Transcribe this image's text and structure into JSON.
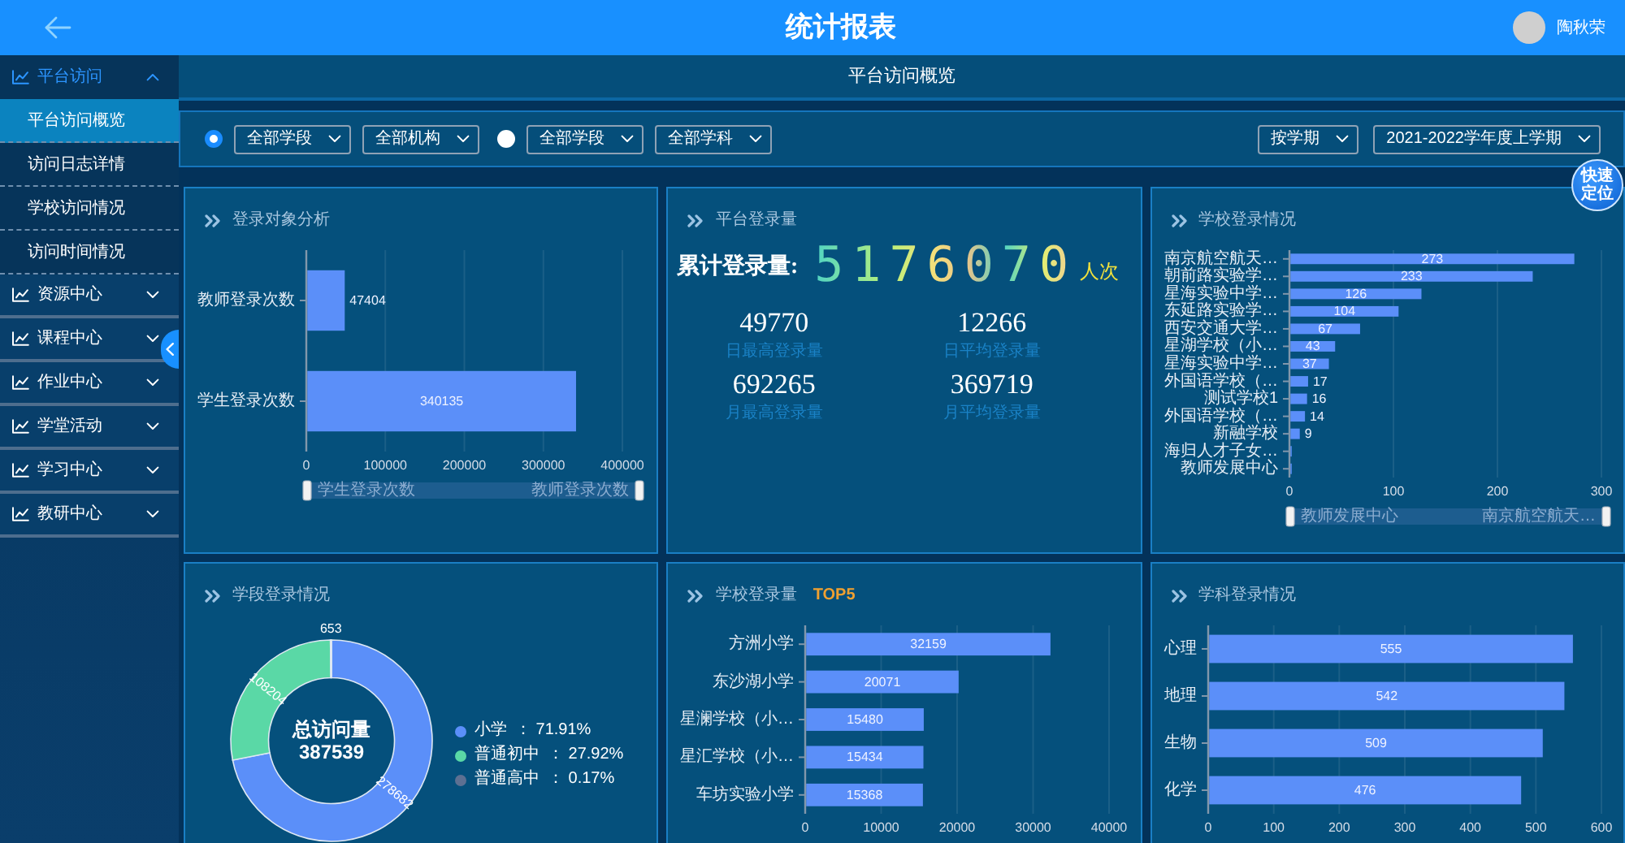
{
  "header": {
    "title": "统计报表",
    "user_name": "陶秋荣"
  },
  "sidebar": {
    "groups": [
      {
        "label": "平台访问",
        "expanded": true,
        "children": [
          {
            "label": "平台访问概览",
            "selected": true
          },
          {
            "label": "访问日志详情",
            "selected": false
          },
          {
            "label": "学校访问情况",
            "selected": false
          },
          {
            "label": "访问时间情况",
            "selected": false
          }
        ]
      },
      {
        "label": "资源中心",
        "expanded": false
      },
      {
        "label": "课程中心",
        "expanded": false
      },
      {
        "label": "作业中心",
        "expanded": false
      },
      {
        "label": "学堂活动",
        "expanded": false
      },
      {
        "label": "学习中心",
        "expanded": false
      },
      {
        "label": "教研中心",
        "expanded": false
      }
    ]
  },
  "page_title": "平台访问概览",
  "filter_groups": [
    {
      "selected": true,
      "selects": [
        "全部学段",
        "全部机构"
      ]
    },
    {
      "selected": false,
      "selects": [
        "全部学段",
        "全部学科"
      ]
    }
  ],
  "term_filters": [
    "按学期",
    "2021-2022学年度上学期"
  ],
  "quick_locate": "快速定位",
  "panels": [
    {
      "kind": "chart",
      "title": "登录对象分析",
      "chart_data": {
        "type": "bar",
        "orientation": "horizontal",
        "categories": [
          "教师登录次数",
          "学生登录次数"
        ],
        "values": [
          47404,
          340135
        ],
        "xlim": [
          0,
          400000
        ],
        "xticks": [
          0,
          100000,
          200000,
          300000,
          400000
        ],
        "data_labels": true,
        "grid": true
      },
      "zoom_slider": {
        "start_label": "学生登录次数",
        "end_label": "教师登录次数"
      }
    },
    {
      "kind": "stats",
      "title": "平台登录量",
      "total": {
        "label": "累计登录量:",
        "value": "5176070",
        "unit": "人次"
      },
      "stats": [
        {
          "value": "49770",
          "label": "日最高登录量"
        },
        {
          "value": "12266",
          "label": "日平均登录量"
        },
        {
          "value": "692265",
          "label": "月最高登录量"
        },
        {
          "value": "369719",
          "label": "月平均登录量"
        }
      ]
    },
    {
      "kind": "chart",
      "title": "学校登录情况",
      "chart_data": {
        "type": "bar",
        "orientation": "horizontal",
        "categories": [
          "南京航空航天…",
          "朝前路实验学…",
          "星海实验中学…",
          "东延路实验学…",
          "西安交通大学…",
          "星湖学校（小…",
          "星海实验中学…",
          "外国语学校（…",
          "测试学校1",
          "外国语学校（…",
          "新融学校",
          "海归人才子女…",
          "教师发展中心"
        ],
        "values": [
          273,
          233,
          126,
          104,
          67,
          43,
          37,
          17,
          16,
          14,
          9,
          1,
          1
        ],
        "value_labels": [
          "273",
          "233",
          "126",
          "104",
          "67",
          "43",
          "37",
          "17",
          "16",
          "14",
          "9",
          null,
          null
        ],
        "xlim": [
          0,
          300
        ],
        "xticks": [
          0,
          100,
          200,
          300
        ],
        "grid": true
      },
      "zoom_slider": {
        "start_label": "教师发展中心",
        "end_label": "南京航空航天…"
      }
    },
    {
      "kind": "chart",
      "title": "学段登录情况",
      "chart_data": {
        "type": "donut",
        "categories": [
          "小学",
          "普通初中",
          "普通高中"
        ],
        "values": [
          278682,
          108204,
          653
        ],
        "data_labels": true
      },
      "center_label": "总访问量",
      "center_value": "387539",
      "legend": [
        {
          "value_text": "： 71.91%",
          "color": "#5b8ff9"
        },
        {
          "value_text": "： 27.92%",
          "color": "#5ad8a6"
        },
        {
          "value_text": "： 0.17%",
          "color": "#5d7092"
        }
      ]
    },
    {
      "kind": "chart",
      "title": "学校登录量",
      "title_badge": "TOP5",
      "chart_data": {
        "type": "bar",
        "orientation": "horizontal",
        "categories": [
          "方洲小学",
          "东沙湖小学",
          "星澜学校（小…",
          "星汇学校（小…",
          "车坊实验小学"
        ],
        "values": [
          32159,
          20071,
          15480,
          15434,
          15368
        ],
        "xlim": [
          0,
          40000
        ],
        "xticks": [
          0,
          10000,
          20000,
          30000,
          40000
        ],
        "data_labels": true,
        "grid": true
      }
    },
    {
      "kind": "chart",
      "title": "学科登录情况",
      "chart_data": {
        "type": "bar",
        "orientation": "horizontal",
        "categories": [
          "心理",
          "地理",
          "生物",
          "化学"
        ],
        "values": [
          555,
          542,
          509,
          476
        ],
        "xlim": [
          0,
          600
        ],
        "xticks": [
          0,
          100,
          200,
          300,
          400,
          500,
          600
        ],
        "data_labels": true,
        "grid": true
      }
    }
  ]
}
